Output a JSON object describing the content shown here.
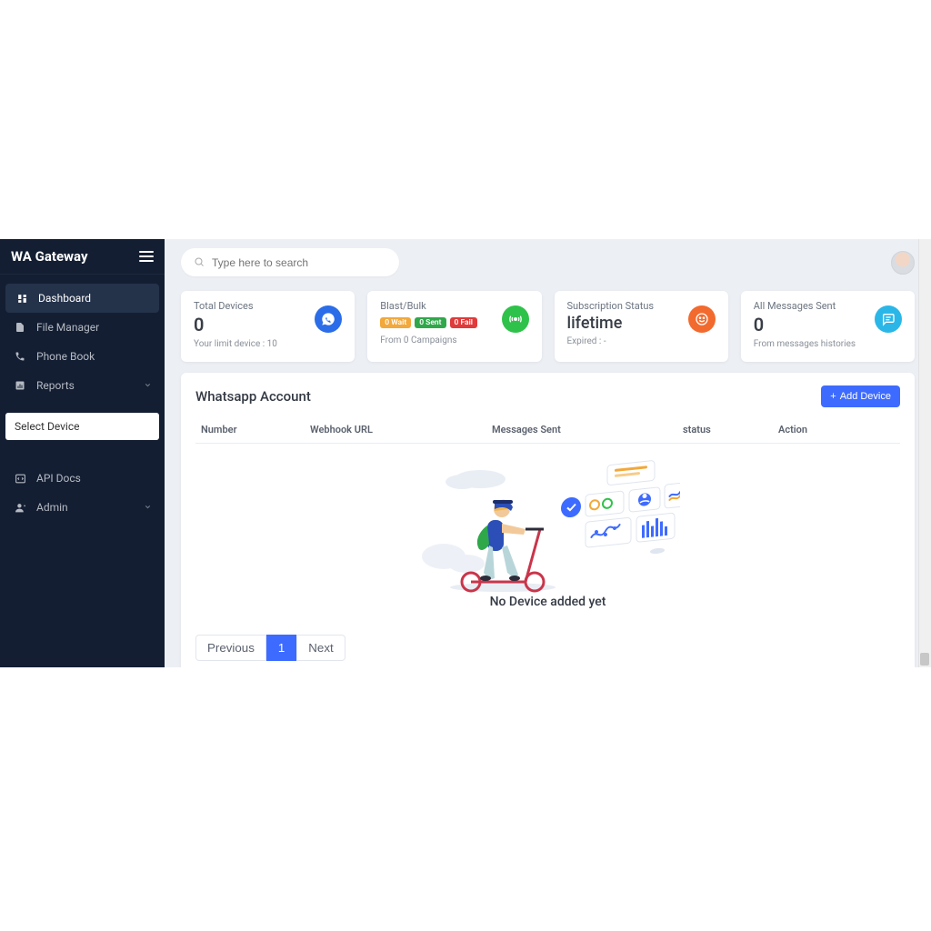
{
  "app_title": "WA Gateway",
  "search": {
    "placeholder": "Type here to search"
  },
  "sidebar": {
    "items": [
      {
        "label": "Dashboard"
      },
      {
        "label": "File Manager"
      },
      {
        "label": "Phone Book"
      },
      {
        "label": "Reports"
      },
      {
        "label": "API Docs"
      },
      {
        "label": "Admin"
      }
    ],
    "device_select": "Select Device"
  },
  "stats": {
    "total_devices": {
      "title": "Total Devices",
      "value": "0",
      "sub": "Your limit device : 10"
    },
    "blast": {
      "title": "Blast/Bulk",
      "pills": {
        "wait": "0 Wait",
        "sent": "0 Sent",
        "fail": "0 Fail"
      },
      "sub": "From 0 Campaigns"
    },
    "subscription": {
      "title": "Subscription Status",
      "value": "lifetime",
      "sub": "Expired : -"
    },
    "messages": {
      "title": "All Messages Sent",
      "value": "0",
      "sub": "From messages histories"
    }
  },
  "panel": {
    "title": "Whatsapp Account",
    "add_btn": "Add Device",
    "columns": {
      "number": "Number",
      "webhook": "Webhook URL",
      "messages": "Messages Sent",
      "status": "status",
      "action": "Action"
    },
    "empty": "No Device added yet",
    "pagination": {
      "prev": "Previous",
      "page": "1",
      "next": "Next"
    }
  }
}
